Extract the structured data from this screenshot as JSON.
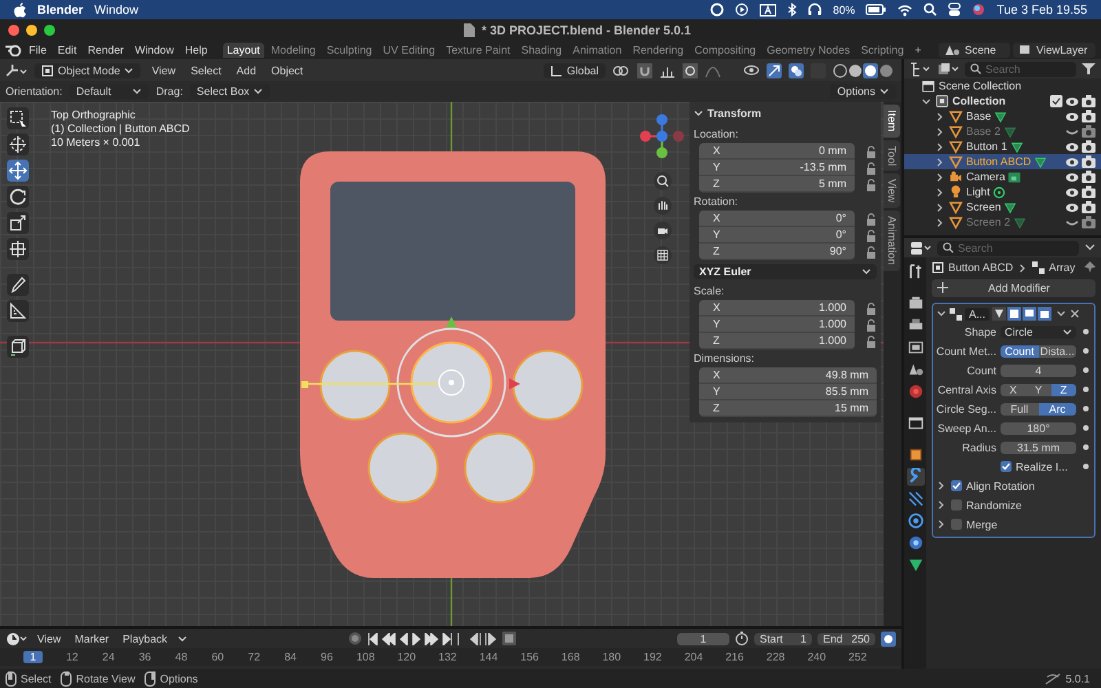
{
  "menubar": {
    "app": "Blender",
    "menus": [
      "Window"
    ],
    "battery": "80%",
    "clock": "Tue 3 Feb  19.55"
  },
  "window": {
    "title": "* 3D PROJECT.blend - Blender 5.0.1"
  },
  "main_menu": [
    "File",
    "Edit",
    "Render",
    "Window",
    "Help"
  ],
  "workspaces": [
    {
      "label": "Layout",
      "selected": true
    },
    {
      "label": "Modeling",
      "selected": false
    },
    {
      "label": "Sculpting",
      "selected": false
    },
    {
      "label": "UV Editing",
      "selected": false
    },
    {
      "label": "Texture Paint",
      "selected": false
    },
    {
      "label": "Shading",
      "selected": false
    },
    {
      "label": "Animation",
      "selected": false
    },
    {
      "label": "Rendering",
      "selected": false
    },
    {
      "label": "Compositing",
      "selected": false
    },
    {
      "label": "Geometry Nodes",
      "selected": false
    },
    {
      "label": "Scripting",
      "selected": false
    }
  ],
  "add_workspace": "+",
  "scene": "Scene",
  "view_layer": "ViewLayer",
  "viewport": {
    "mode": "Object Mode",
    "menus": [
      "View",
      "Select",
      "Add",
      "Object"
    ],
    "orientation": "Global",
    "tool_settings": {
      "orientation_label": "Orientation:",
      "orientation": "Default",
      "drag_label": "Drag:",
      "drag": "Select Box"
    },
    "options": "Options",
    "overlay": [
      "Top Orthographic",
      "(1) Collection | Button ABCD",
      "10 Meters × 0.001"
    ],
    "tools": [
      {
        "kind": "select",
        "selected": false
      },
      {
        "kind": "cursor",
        "selected": false
      },
      {
        "kind": "move",
        "selected": true
      },
      {
        "kind": "rotate",
        "selected": false
      },
      {
        "kind": "scale",
        "selected": false
      },
      {
        "kind": "transform",
        "selected": false
      },
      {
        "kind": "annotate",
        "selected": false
      },
      {
        "kind": "measure",
        "selected": false
      },
      {
        "kind": "add-cube",
        "selected": false
      }
    ]
  },
  "transform": {
    "title": "Transform",
    "groups": [
      {
        "label": "Location:",
        "lockable": true,
        "fields": [
          {
            "axis": "X",
            "value": "0 mm"
          },
          {
            "axis": "Y",
            "value": "-13.5 mm"
          },
          {
            "axis": "Z",
            "value": "5 mm"
          }
        ]
      },
      {
        "label": "Rotation:",
        "lockable": true,
        "fields": [
          {
            "axis": "X",
            "value": "0°"
          },
          {
            "axis": "Y",
            "value": "0°"
          },
          {
            "axis": "Z",
            "value": "90°"
          }
        ],
        "mode": "XYZ Euler"
      },
      {
        "label": "Scale:",
        "lockable": true,
        "fields": [
          {
            "axis": "X",
            "value": "1.000"
          },
          {
            "axis": "Y",
            "value": "1.000"
          },
          {
            "axis": "Z",
            "value": "1.000"
          }
        ]
      },
      {
        "label": "Dimensions:",
        "lockable": false,
        "fields": [
          {
            "axis": "X",
            "value": "49.8 mm"
          },
          {
            "axis": "Y",
            "value": "85.5 mm"
          },
          {
            "axis": "Z",
            "value": "15 mm"
          }
        ]
      }
    ]
  },
  "side_tabs": [
    {
      "label": "Item",
      "selected": true
    },
    {
      "label": "Tool",
      "selected": false
    },
    {
      "label": "View",
      "selected": false
    },
    {
      "label": "Animation",
      "selected": false
    }
  ],
  "outliner": {
    "search_placeholder": "Search",
    "tree": [
      {
        "label": "Scene Collection",
        "kind": "scene",
        "selected": false,
        "children": [
          {
            "label": "Collection",
            "kind": "collection",
            "selected": false,
            "expanded": true,
            "children": [
              {
                "label": "Base",
                "kind": "mesh",
                "selected": false,
                "expanded": false,
                "hidden": false
              },
              {
                "label": "Base 2",
                "kind": "mesh",
                "selected": false,
                "expanded": false,
                "hidden": true
              },
              {
                "label": "Button 1",
                "kind": "mesh",
                "selected": false,
                "expanded": false,
                "hidden": false
              },
              {
                "label": "Button ABCD",
                "kind": "mesh",
                "selected": true,
                "expanded": false,
                "hidden": false
              },
              {
                "label": "Camera",
                "kind": "camera",
                "selected": false,
                "expanded": false,
                "hidden": false
              },
              {
                "label": "Light",
                "kind": "light",
                "selected": false,
                "expanded": false,
                "hidden": false
              },
              {
                "label": "Screen",
                "kind": "mesh",
                "selected": false,
                "expanded": false,
                "hidden": false
              },
              {
                "label": "Screen 2",
                "kind": "mesh",
                "selected": false,
                "expanded": false,
                "hidden": true
              }
            ]
          }
        ]
      }
    ]
  },
  "properties": {
    "search_placeholder": "Search",
    "tabs": [
      {
        "kind": "tool",
        "selected": false
      },
      {
        "kind": "render",
        "selected": false
      },
      {
        "kind": "output",
        "selected": false
      },
      {
        "kind": "view",
        "selected": false
      },
      {
        "kind": "scene",
        "selected": false
      },
      {
        "kind": "world",
        "selected": false
      },
      {
        "kind": "collection",
        "selected": false
      },
      {
        "kind": "object",
        "selected": false
      },
      {
        "kind": "modifiers",
        "selected": true
      },
      {
        "kind": "particles",
        "selected": false
      },
      {
        "kind": "physics",
        "selected": false
      },
      {
        "kind": "constraints",
        "selected": false
      },
      {
        "kind": "data",
        "selected": false
      }
    ],
    "breadcrumb": [
      "Button ABCD",
      "Array"
    ],
    "add_modifier": "Add Modifier",
    "modifier": {
      "name": "A...",
      "expanded": true,
      "rows": [
        {
          "kind": "dropdown",
          "label": "Shape",
          "value": "Circle"
        },
        {
          "kind": "segmented",
          "label": "Count Met...",
          "options": [
            {
              "label": "Count",
              "selected": true
            },
            {
              "label": "Dista...",
              "selected": false
            }
          ]
        },
        {
          "kind": "number",
          "label": "Count",
          "value": "4"
        },
        {
          "kind": "segmented",
          "label": "Central Axis",
          "options": [
            {
              "label": "X",
              "selected": false
            },
            {
              "label": "Y",
              "selected": false
            },
            {
              "label": "Z",
              "selected": true
            }
          ]
        },
        {
          "kind": "segmented",
          "label": "Circle Seg...",
          "options": [
            {
              "label": "Full",
              "selected": false
            },
            {
              "label": "Arc",
              "selected": true
            }
          ]
        },
        {
          "kind": "number",
          "label": "Sweep An...",
          "value": "180°"
        },
        {
          "kind": "number",
          "label": "Radius",
          "value": "31.5 mm"
        },
        {
          "kind": "checkbox",
          "label": "Realize I...",
          "checked": true
        }
      ],
      "subpanels": [
        {
          "label": "Align Rotation",
          "checked": true,
          "expanded": false
        },
        {
          "label": "Randomize",
          "checked": false,
          "expanded": false
        },
        {
          "label": "Merge",
          "checked": false,
          "expanded": false
        }
      ]
    }
  },
  "timeline": {
    "menus": [
      "View",
      "Marker",
      "Playback"
    ],
    "current_frame": "1",
    "start_label": "Start",
    "start": "1",
    "end_label": "End",
    "end": "250",
    "ticks": [
      {
        "label": "1",
        "selected": true
      },
      {
        "label": "12",
        "selected": false
      },
      {
        "label": "24",
        "selected": false
      },
      {
        "label": "36",
        "selected": false
      },
      {
        "label": "48",
        "selected": false
      },
      {
        "label": "60",
        "selected": false
      },
      {
        "label": "72",
        "selected": false
      },
      {
        "label": "84",
        "selected": false
      },
      {
        "label": "96",
        "selected": false
      },
      {
        "label": "108",
        "selected": false
      },
      {
        "label": "120",
        "selected": false
      },
      {
        "label": "132",
        "selected": false
      },
      {
        "label": "144",
        "selected": false
      },
      {
        "label": "156",
        "selected": false
      },
      {
        "label": "168",
        "selected": false
      },
      {
        "label": "180",
        "selected": false
      },
      {
        "label": "192",
        "selected": false
      },
      {
        "label": "204",
        "selected": false
      },
      {
        "label": "216",
        "selected": false
      },
      {
        "label": "228",
        "selected": false
      },
      {
        "label": "240",
        "selected": false
      },
      {
        "label": "252",
        "selected": false
      }
    ]
  },
  "status_bar": {
    "items": [
      {
        "kind": "left",
        "label": "Select"
      },
      {
        "kind": "middle",
        "label": "Rotate View"
      },
      {
        "kind": "right",
        "label": "Options"
      }
    ],
    "version": "5.0.1"
  }
}
